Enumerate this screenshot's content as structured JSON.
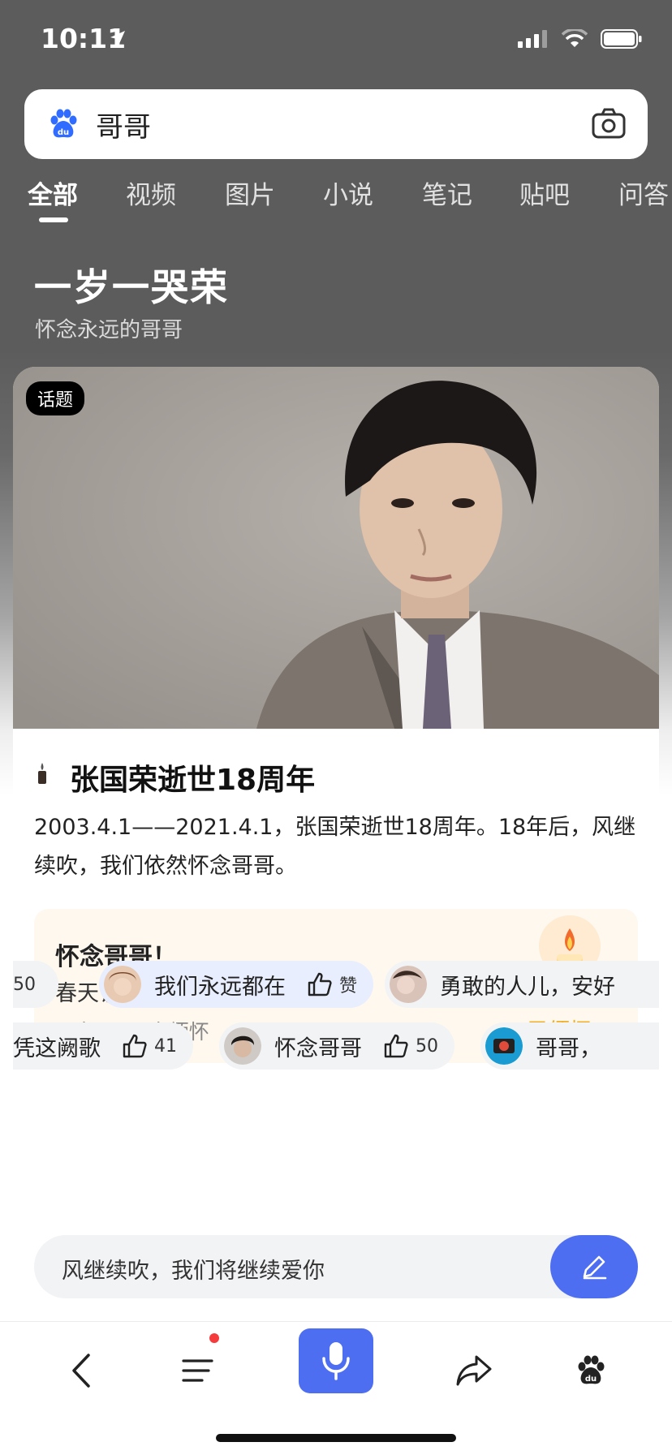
{
  "status_bar": {
    "time": "10:11",
    "icons": [
      "location-arrow-icon",
      "signal-icon",
      "wifi-icon",
      "battery-icon"
    ]
  },
  "search": {
    "logo": "baidu-paw-logo",
    "query": "哥哥",
    "camera_icon": "camera-icon"
  },
  "tabs": [
    {
      "label": "全部",
      "active": true
    },
    {
      "label": "视频"
    },
    {
      "label": "图片"
    },
    {
      "label": "小说"
    },
    {
      "label": "笔记"
    },
    {
      "label": "贴吧"
    },
    {
      "label": "问答"
    }
  ],
  "topic": {
    "title": "一岁一哭荣",
    "subtitle": "怀念永远的哥哥"
  },
  "card": {
    "badge": "话题",
    "headline": "张国荣逝世18周年",
    "description": "2003.4.1——2021.4.1，张国荣逝世18周年。18年后，风继续吹，我们依然怀念哥哥。"
  },
  "memorial": {
    "title": "怀念哥哥！",
    "quote": "春天该很好 你若尚在场",
    "count": "已有4.5万人缅怀",
    "status": "已缅怀"
  },
  "comments_row1": [
    {
      "text": "",
      "likes": "50"
    },
    {
      "text": "我们永远都在",
      "likes": "赞"
    },
    {
      "text": "勇敢的人儿，安好"
    }
  ],
  "comments_row2": [
    {
      "text": "凭这阙歌",
      "likes": "41"
    },
    {
      "text": "怀念哥哥",
      "likes": "50"
    },
    {
      "text": "哥哥，"
    }
  ],
  "comment_input": {
    "placeholder": "风继续吹，我们将继续爱你"
  },
  "bottom_nav": [
    "back-icon",
    "menu-icon",
    "microphone-icon",
    "share-icon",
    "baidu-paw-icon"
  ],
  "colors": {
    "accent": "#4e6ef2",
    "memorial_bg": "#fef8ee",
    "memorial_status": "#f0b02a",
    "notification_dot": "#f53b3b"
  }
}
